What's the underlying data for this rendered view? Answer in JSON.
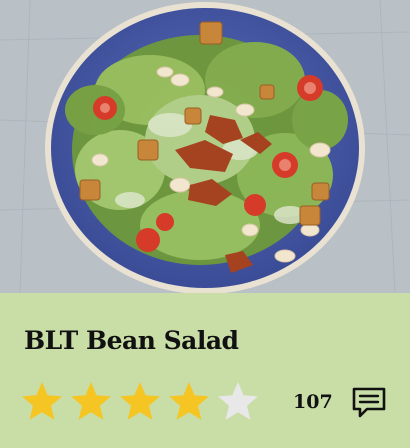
{
  "recipe": {
    "title": "BLT Bean Salad",
    "rating": 4,
    "rating_max": 5,
    "review_count": "107"
  },
  "colors": {
    "info_background": "#c9dda7",
    "star_filled": "#f5c623",
    "star_empty": "#e8e8e8",
    "plate": "#4a5ba8"
  },
  "icons": {
    "comment": "comment-icon",
    "star": "star-icon"
  }
}
